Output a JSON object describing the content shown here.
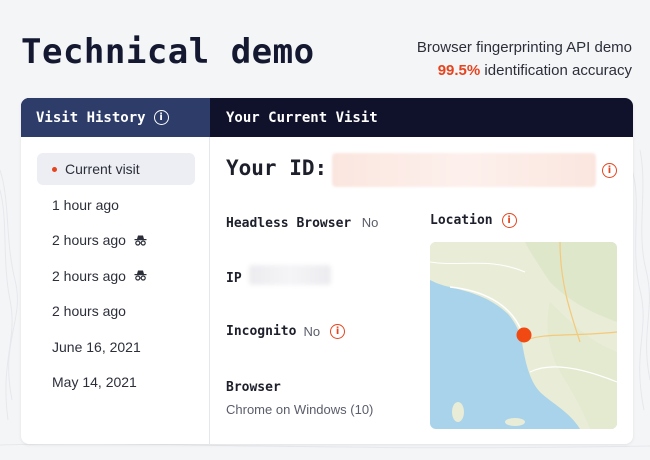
{
  "header": {
    "title": "Technical demo",
    "subtitle": "Browser fingerprinting API demo",
    "accuracy_value": "99.5%",
    "accuracy_text": "identification accuracy"
  },
  "history": {
    "title": "Visit History",
    "items": [
      {
        "label": "Current visit",
        "active": true
      },
      {
        "label": "1 hour ago"
      },
      {
        "label": "2 hours ago",
        "incognito": true
      },
      {
        "label": "2 hours ago",
        "incognito": true
      },
      {
        "label": "2 hours ago"
      },
      {
        "label": "June 16, 2021"
      },
      {
        "label": "May 14, 2021"
      }
    ]
  },
  "current": {
    "title": "Your Current Visit",
    "your_id_label": "Your ID:",
    "headless_label": "Headless Browser",
    "headless_value": "No",
    "ip_label": "IP",
    "incognito_label": "Incognito",
    "incognito_value": "No",
    "browser_label": "Browser",
    "browser_value": "Chrome on Windows (10)",
    "location_label": "Location"
  },
  "colors": {
    "accent": "#e5441e",
    "header_dark": "#10122b",
    "header_tab": "#2e3c69"
  },
  "icons": {
    "info": "info-icon",
    "incognito": "incognito-icon",
    "location_marker": "location-marker-icon"
  }
}
